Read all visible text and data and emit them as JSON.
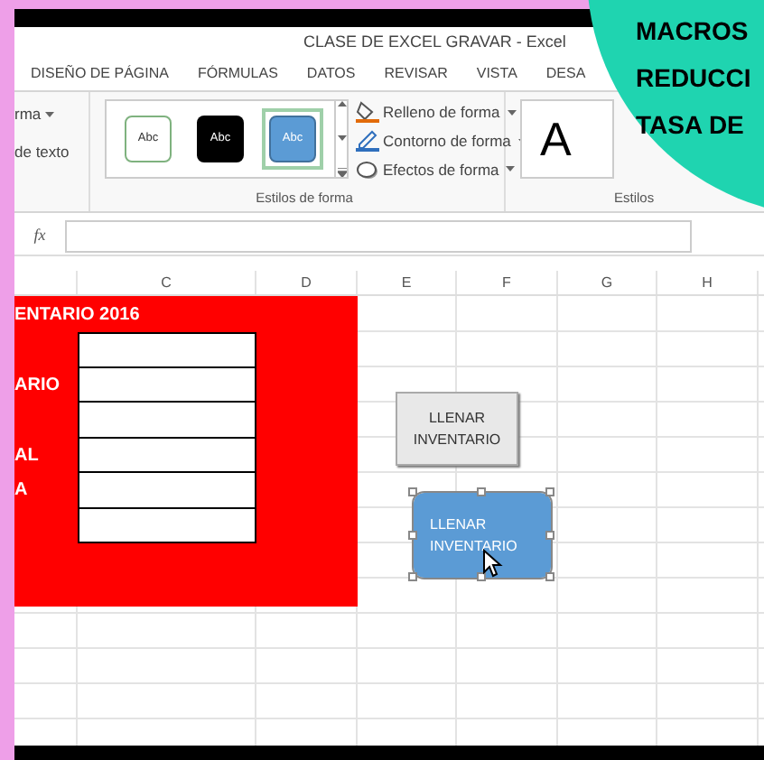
{
  "window": {
    "title": "CLASE DE EXCEL GRAVAR - Excel"
  },
  "tabs": [
    {
      "label": "DISEÑO DE PÁGINA",
      "selected": false
    },
    {
      "label": "FÓRMULAS",
      "selected": false
    },
    {
      "label": "DATOS",
      "selected": false
    },
    {
      "label": "REVISAR",
      "selected": false
    },
    {
      "label": "VISTA",
      "selected": false
    },
    {
      "label": "DESA",
      "selected": false
    }
  ],
  "ribbon": {
    "partial_items": [
      {
        "label": "rma",
        "dropdown": true
      },
      {
        "label": "de texto",
        "dropdown": false
      }
    ],
    "shape_styles": [
      {
        "label": "Abc",
        "kind": "outline",
        "selected": false
      },
      {
        "label": "Abc",
        "kind": "dark",
        "selected": false
      },
      {
        "label": "Abc",
        "kind": "blue",
        "selected": true
      }
    ],
    "shape_commands": [
      {
        "label": "Relleno de forma",
        "kind": "fill"
      },
      {
        "label": "Contorno de forma",
        "kind": "outline"
      },
      {
        "label": "Efectos de forma",
        "kind": "effects"
      }
    ],
    "shape_group_label": "Estilos de forma",
    "wordart": [
      {
        "label": "A",
        "kind": "plain"
      }
    ],
    "wordart_group_label": "Estilos"
  },
  "formula_bar": {
    "function_label": "fx"
  },
  "columns": [
    "",
    "C",
    "D",
    "E",
    "F",
    "G",
    "H"
  ],
  "sheet": {
    "title": "ENTARIO 2016",
    "rows": [
      {},
      {
        "label": "ARIO"
      },
      {},
      {
        "label": "AL"
      },
      {
        "label": "A"
      },
      {}
    ]
  },
  "shapes": [
    {
      "label": "LLENAR INVENTARIO",
      "kind": "button",
      "selected": false
    },
    {
      "label": "LLENAR INVENTARIO",
      "kind": "rounded",
      "selected": true
    }
  ],
  "overlay": {
    "lines": [
      "MACROS",
      "REDUCCI",
      "TASA DE"
    ]
  }
}
